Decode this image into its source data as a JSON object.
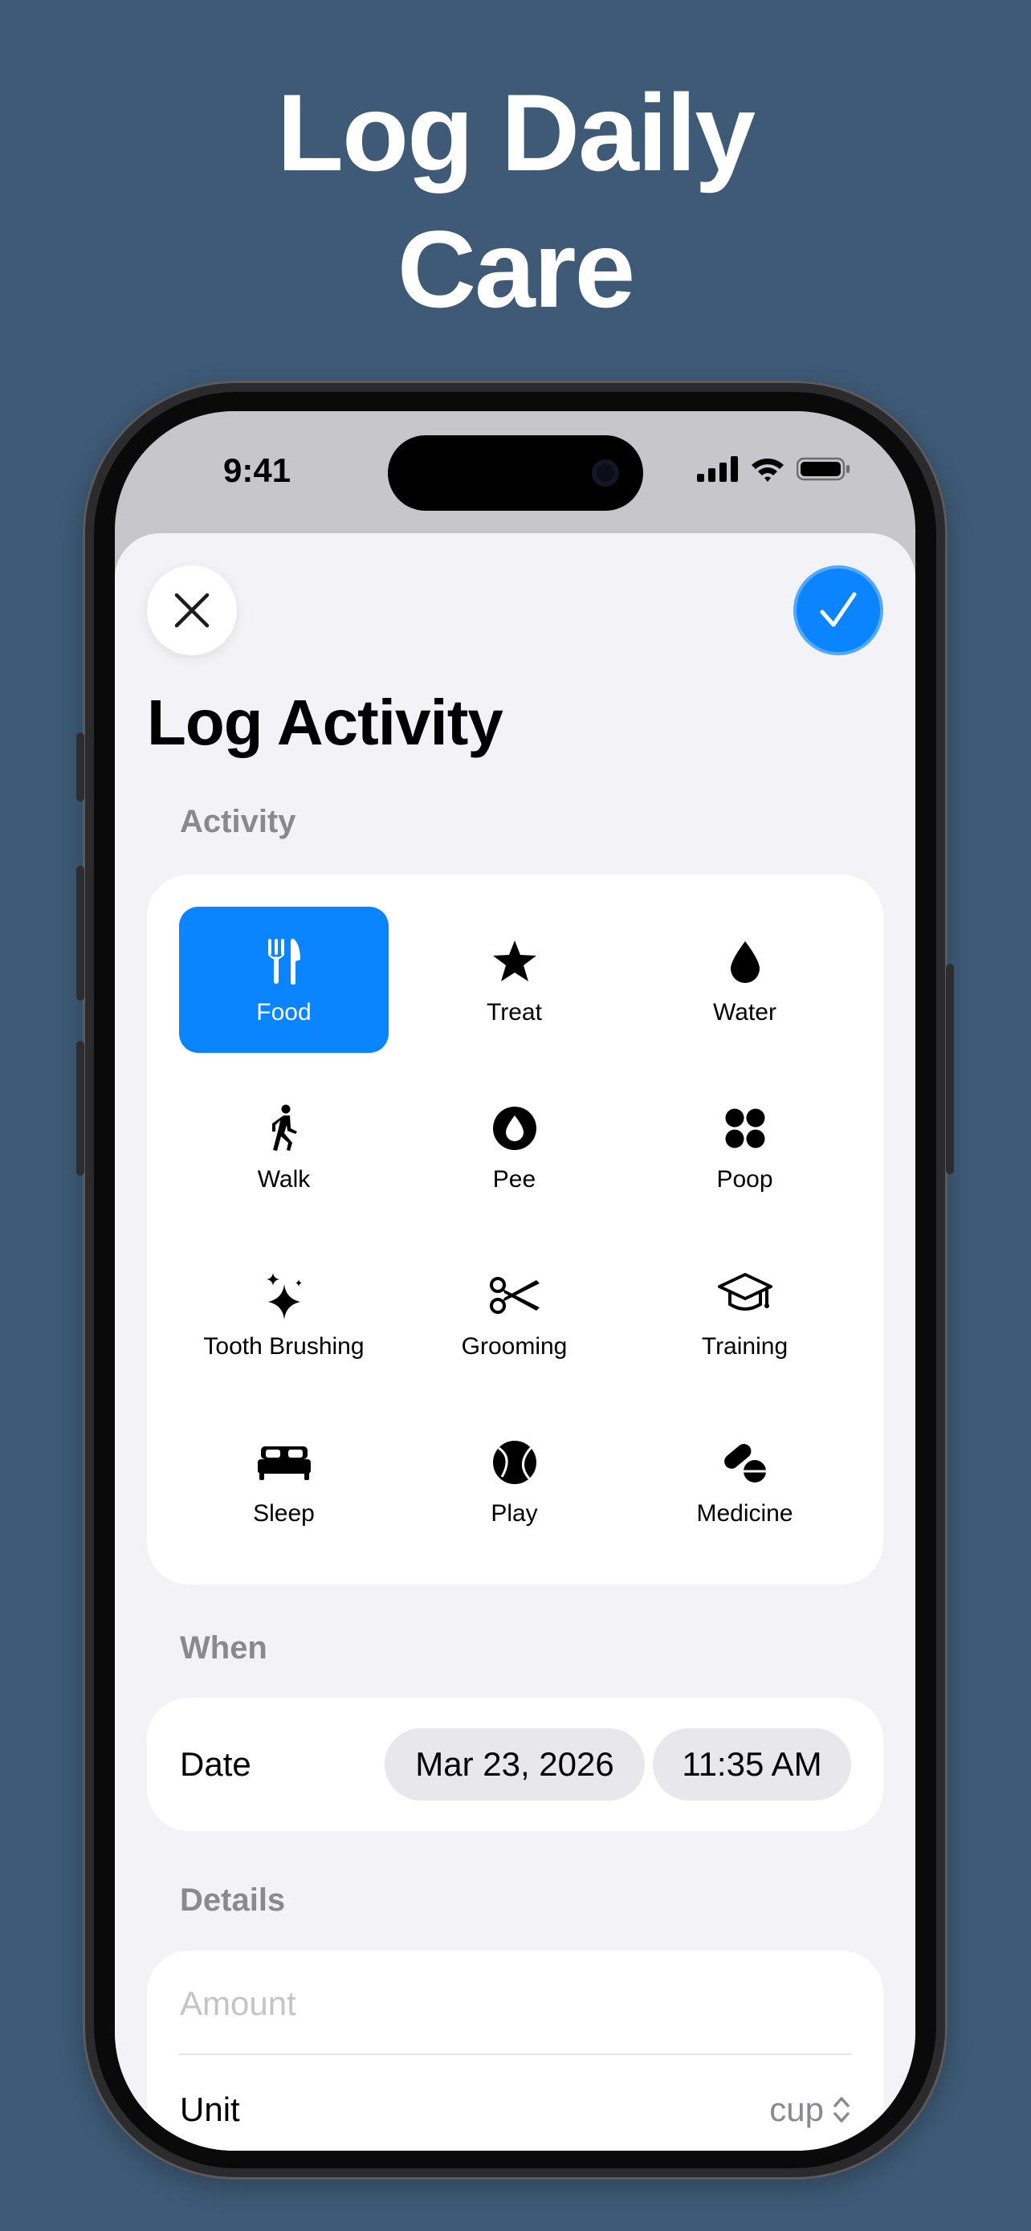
{
  "headline": {
    "line1": "Log Daily",
    "line2": "Care"
  },
  "status": {
    "time": "9:41"
  },
  "sheet": {
    "title": "Log Activity",
    "close_icon": "xmark-icon",
    "done_icon": "checkmark-icon",
    "accent": "#0a84ff"
  },
  "activity": {
    "label": "Activity",
    "selected": "Food",
    "items": [
      {
        "label": "Food",
        "icon": "fork-knife-icon"
      },
      {
        "label": "Treat",
        "icon": "star-icon"
      },
      {
        "label": "Water",
        "icon": "drop-icon"
      },
      {
        "label": "Walk",
        "icon": "walking-figure-icon"
      },
      {
        "label": "Pee",
        "icon": "drop-circle-icon"
      },
      {
        "label": "Poop",
        "icon": "four-circles-icon"
      },
      {
        "label": "Tooth Brushing",
        "icon": "sparkles-icon"
      },
      {
        "label": "Grooming",
        "icon": "scissors-icon"
      },
      {
        "label": "Training",
        "icon": "graduation-cap-icon"
      },
      {
        "label": "Sleep",
        "icon": "bed-icon"
      },
      {
        "label": "Play",
        "icon": "tennis-ball-icon"
      },
      {
        "label": "Medicine",
        "icon": "pills-icon"
      }
    ]
  },
  "when": {
    "label": "When",
    "date_label": "Date",
    "date_value": "Mar 23, 2026",
    "time_value": "11:35 AM"
  },
  "details": {
    "label": "Details",
    "amount_placeholder": "Amount",
    "unit_label": "Unit",
    "unit_value": "cup"
  }
}
